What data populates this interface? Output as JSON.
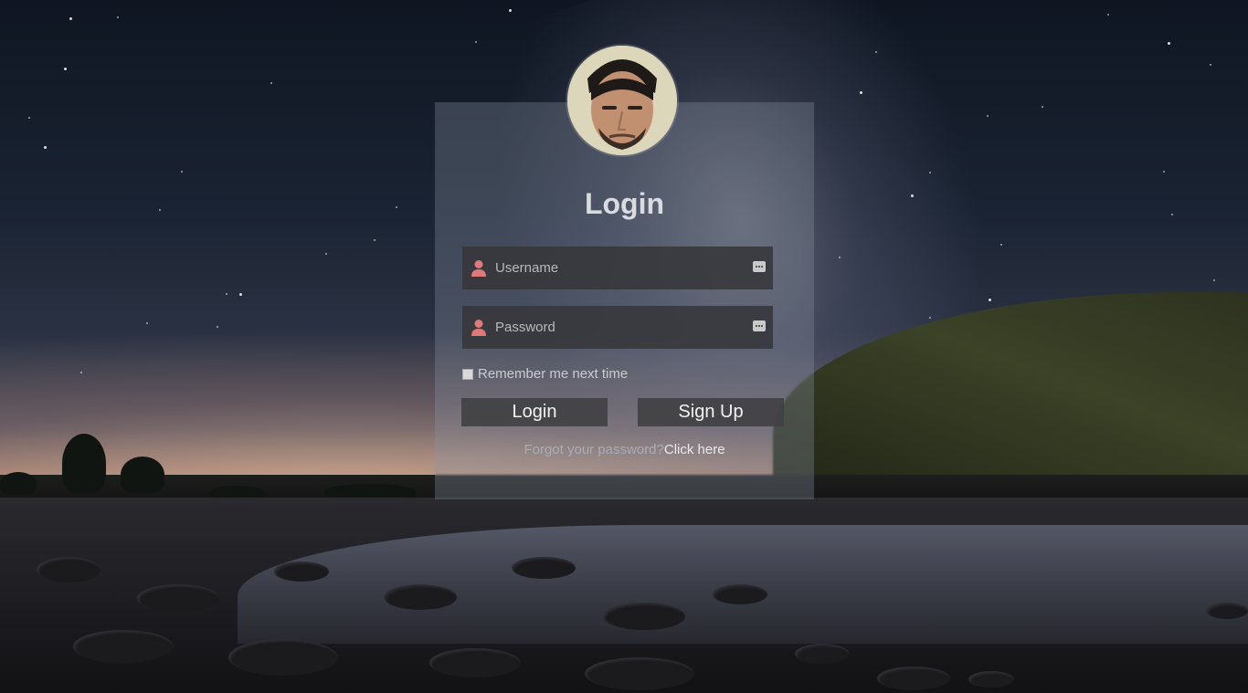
{
  "form": {
    "title": "Login",
    "username_placeholder": "Username",
    "password_placeholder": "Password",
    "remember_label": "Remember me next time",
    "remember_checked": false,
    "login_button": "Login",
    "signup_button": "Sign Up",
    "forgot_text": "Forgot your password?",
    "forgot_link": "Click here"
  },
  "icons": {
    "field_icon": "user-icon",
    "field_icon_color": "#e07a7a",
    "field_action_icon": "more-dots-icon"
  }
}
